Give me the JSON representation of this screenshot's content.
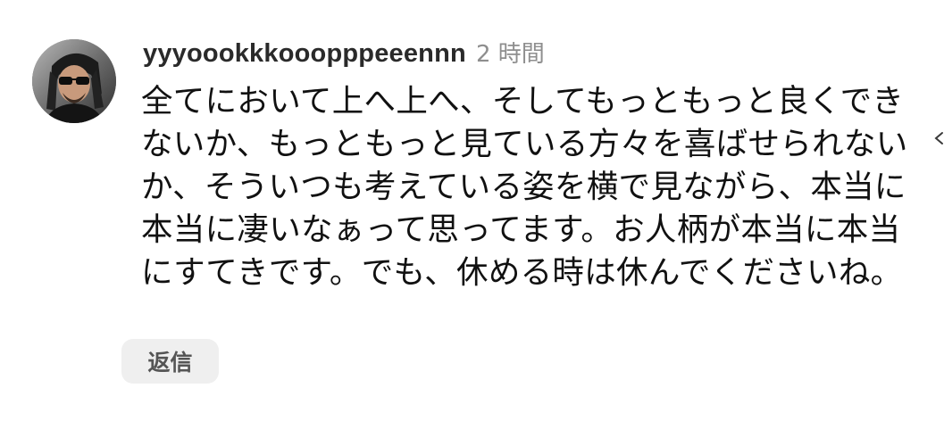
{
  "comment": {
    "username": "yyyoookkkooopppeeennn",
    "timestamp": "2 時間",
    "text": "全てにおいて上へ上へ、そしてもっともっと良くできないか、もっともっと見ている方々を喜ばせられないか、そういつも考えている姿を横で見ながら、本当に本当に凄いなぁって思ってます。お人柄が本当に本当にすてきです。でも、休める時は休んでくださいね。",
    "reply_label": "返信"
  },
  "icons": {
    "avatar": "user-avatar",
    "edge": "chevron-left-icon"
  },
  "colors": {
    "username": "#2a2a2a",
    "timestamp": "#8e8e8e",
    "text": "#111111",
    "reply_bg": "#efefef",
    "reply_text": "#555555"
  }
}
